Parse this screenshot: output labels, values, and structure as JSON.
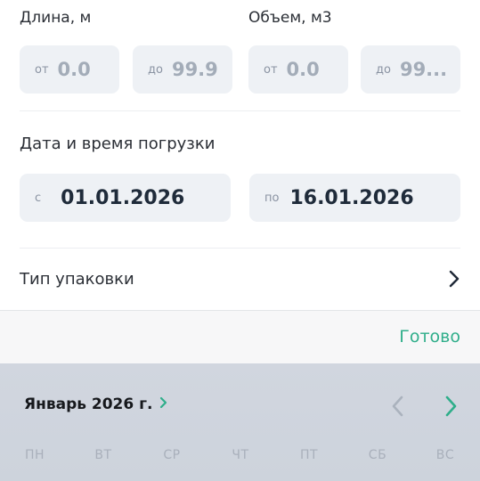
{
  "length": {
    "label": "Длина, м",
    "from_prefix": "от",
    "from_value": "0.0",
    "to_prefix": "до",
    "to_value": "99.9"
  },
  "volume": {
    "label": "Объем, м3",
    "from_prefix": "от",
    "from_value": "0.0",
    "to_prefix": "до",
    "to_value": "99..."
  },
  "loading_date": {
    "label": "Дата и время погрузки",
    "from_prefix": "с",
    "from_value": "01.01.2026",
    "to_prefix": "по",
    "to_value": "16.01.2026"
  },
  "packaging": {
    "label": "Тип упаковки"
  },
  "toolbar": {
    "done_label": "Готово"
  },
  "calendar": {
    "month_label": "Январь 2026 г.",
    "weekdays": [
      "ПН",
      "ВТ",
      "СР",
      "ЧТ",
      "ПТ",
      "СБ",
      "ВС"
    ]
  },
  "colors": {
    "accent": "#2fae8a",
    "field_bg": "#eef1f5"
  }
}
